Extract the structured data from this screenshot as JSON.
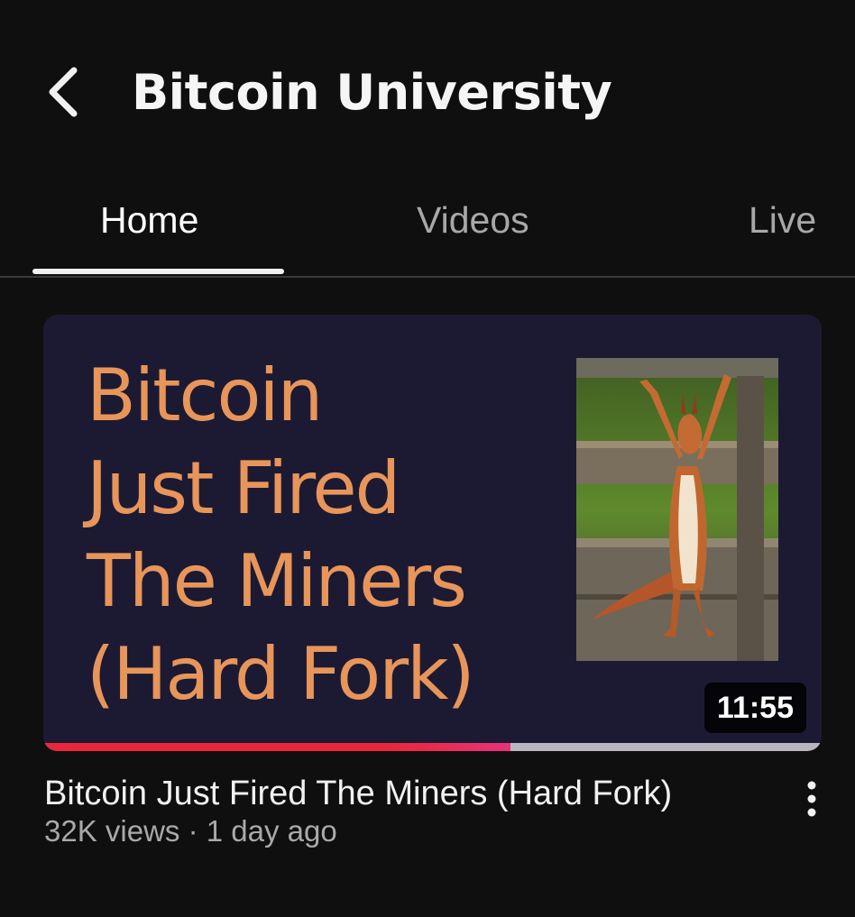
{
  "header": {
    "back_icon": "chevron-left-icon",
    "title": "Bitcoin University"
  },
  "tabs": [
    {
      "label": "Home",
      "active": true
    },
    {
      "label": "Videos",
      "active": false
    },
    {
      "label": "Live",
      "active": false
    }
  ],
  "video": {
    "thumbnail_text": [
      "Bitcoin",
      "Just Fired",
      "The Miners",
      "(Hard Fork)"
    ],
    "duration": "11:55",
    "watch_progress_percent": 60,
    "title": "Bitcoin Just Fired The Miners (Hard Fork)",
    "meta": "32K views · 1 day ago",
    "more_icon": "more-vertical-icon"
  },
  "colors": {
    "background": "#0f0f0f",
    "thumbnail_bg": "#1c1a33",
    "thumbnail_text": "#e8955a",
    "progress": "#e8283a",
    "inactive_tab": "#a8a8a8"
  }
}
